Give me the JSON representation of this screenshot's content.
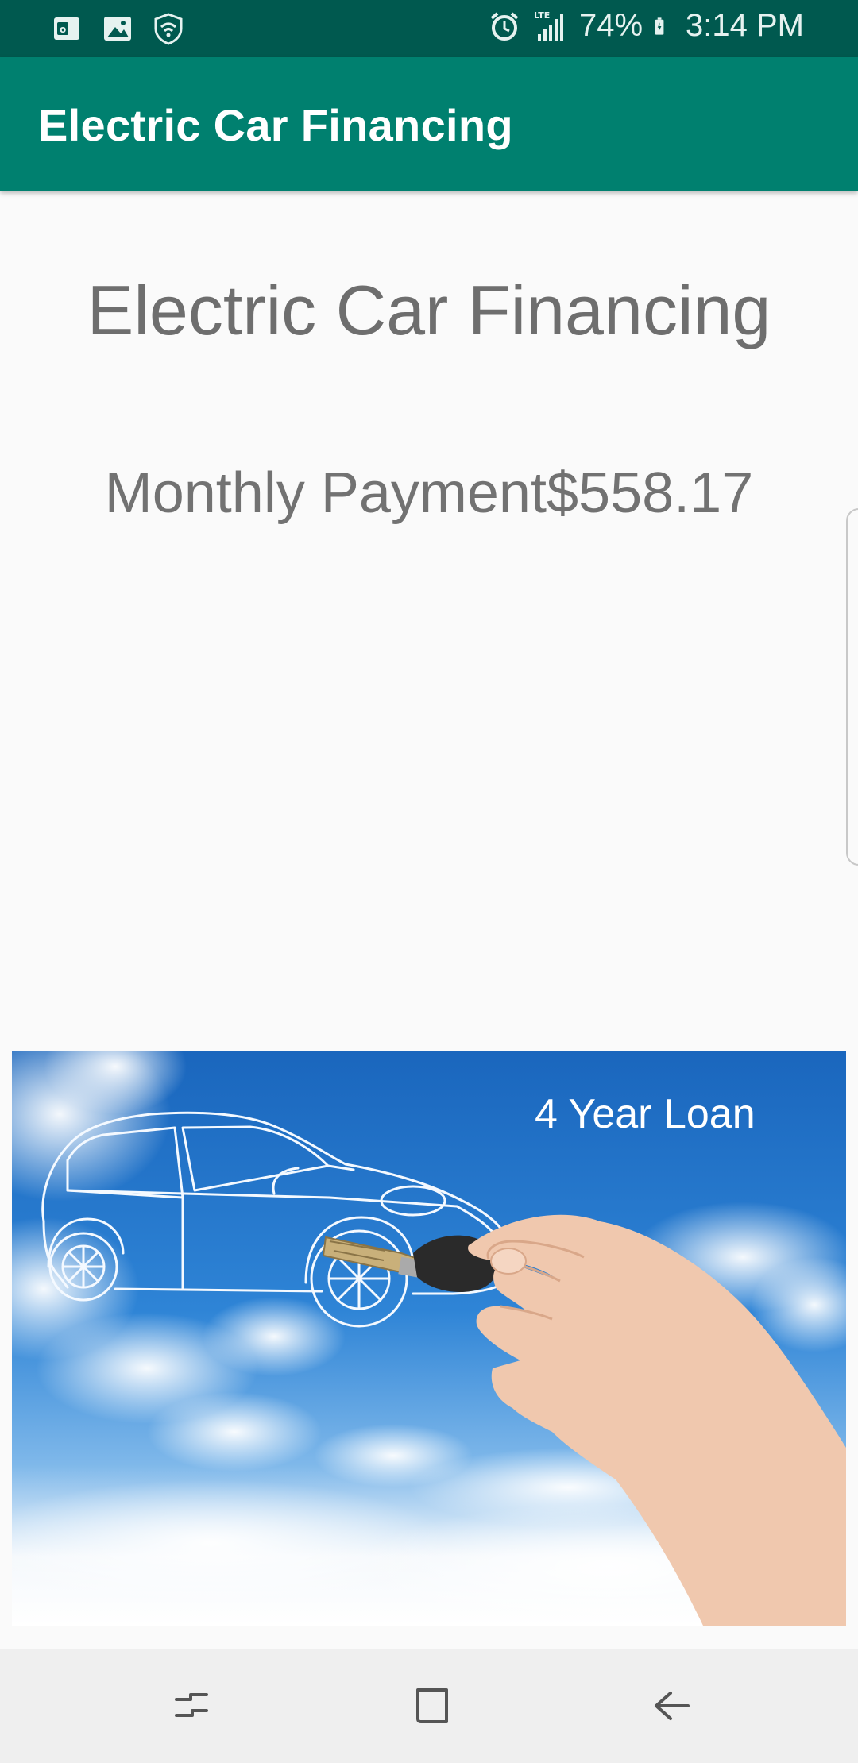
{
  "status_bar": {
    "left_icons": [
      "outlook-icon",
      "gallery-icon",
      "shield-wifi-icon"
    ],
    "right_icons": [
      "alarm-icon",
      "lte-signal-icon",
      "battery-icon"
    ],
    "lte_label": "LTE",
    "battery": "74%",
    "time": "3:14 PM"
  },
  "app_bar": {
    "title": "Electric Car Financing"
  },
  "main": {
    "heading": "Electric Car Financing",
    "monthly_payment": "Monthly Payment$558.17",
    "banner": {
      "caption": "4 Year Loan",
      "colors": {
        "sky_top": "#1b6dc2",
        "sky_mid": "#3b8fdc",
        "cloud": "#ffffff"
      }
    }
  },
  "nav_bar": {
    "buttons": [
      "recents-icon",
      "home-icon",
      "back-icon"
    ]
  },
  "colors": {
    "status_bar": "#00594f",
    "app_bar": "#00806f",
    "text_primary": "#6e6e6e",
    "background": "#fafafa"
  }
}
